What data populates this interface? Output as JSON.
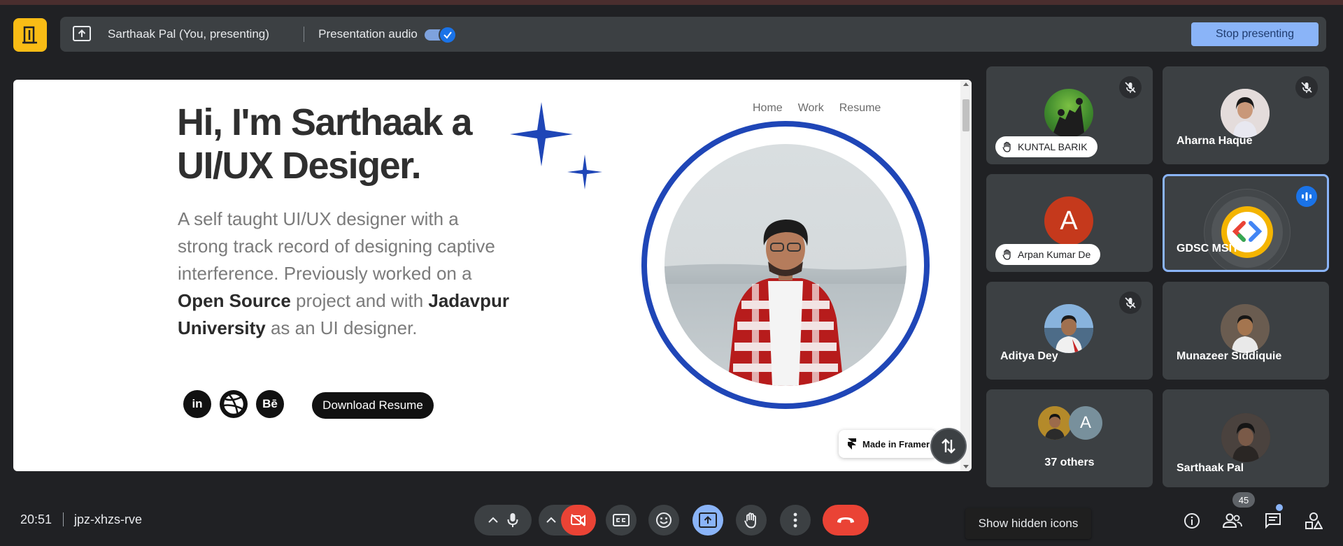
{
  "present_bar": {
    "presenter_label": "Sarthaak Pal (You, presenting)",
    "audio_label": "Presentation audio",
    "audio_on": true,
    "stop_label": "Stop presenting"
  },
  "slide": {
    "title": "Hi, I'm Sarthaak a UI/UX Desiger.",
    "desc_1": "A self taught UI/UX designer with a strong track record of designing captive interference. Previously worked on a ",
    "desc_bold_1": "Open Source",
    "desc_2": " project and with ",
    "desc_bold_2": "Jadavpur University",
    "desc_3": " as an UI designer.",
    "nav": [
      "Home",
      "Work",
      "Resume"
    ],
    "social": [
      "in",
      "Bē"
    ],
    "download_label": "Download Resume",
    "badge_label": "Made in Framer",
    "accent_color": "#1f46b7"
  },
  "participants": [
    {
      "name": "KUNTAL BARIK",
      "raised_hand": true,
      "muted": true
    },
    {
      "name": "Aharna Haque",
      "muted": true
    },
    {
      "name": "Arpan Kumar De",
      "raised_hand": true,
      "initial": "A",
      "avatar_color": "#c5391c"
    },
    {
      "name": "GDSC MSIT",
      "speaking": true
    },
    {
      "name": "Aditya Dey",
      "muted": true
    },
    {
      "name": "Munazeer Siddiquie"
    },
    {
      "name": "37 others",
      "initial": "A"
    },
    {
      "name": "Sarthaak Pal"
    }
  ],
  "bottom": {
    "time": "20:51",
    "meeting_code": "jpz-xhzs-rve",
    "tooltip": "Show hidden icons",
    "people_count": "45"
  }
}
